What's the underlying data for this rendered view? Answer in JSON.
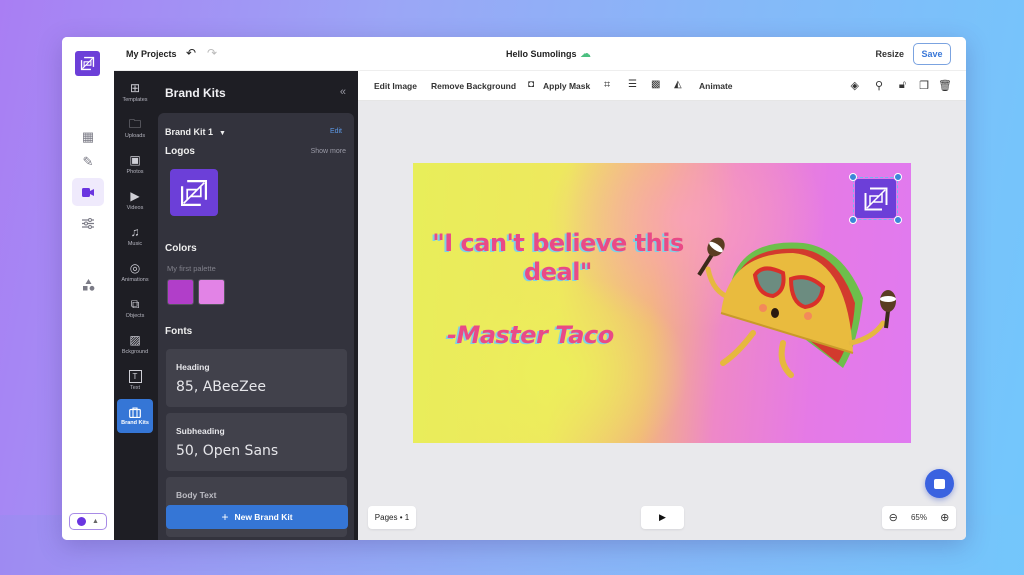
{
  "topbar": {
    "my_projects": "My Projects",
    "undo_icon": "↶",
    "redo_icon": "↷",
    "doc_title": "Hello Sumolings",
    "cloud_icon": "☁",
    "resize_label": "Resize",
    "save_label": "Save"
  },
  "rail": {
    "items": [
      {
        "name": "calendar",
        "icon": "▦"
      },
      {
        "name": "pencil",
        "icon": "✎"
      },
      {
        "name": "video",
        "icon": "■"
      },
      {
        "name": "sliders",
        "icon": "☰"
      },
      {
        "name": "shapes",
        "icon": "▲"
      }
    ],
    "active": "video"
  },
  "tools": [
    {
      "label": "Templates",
      "icon": "⊞"
    },
    {
      "label": "Uploads",
      "icon": "🗀"
    },
    {
      "label": "Photos",
      "icon": "▣"
    },
    {
      "label": "Videos",
      "icon": "▶"
    },
    {
      "label": "Music",
      "icon": "♫"
    },
    {
      "label": "Animations",
      "icon": "◎"
    },
    {
      "label": "Objects",
      "icon": "⧉"
    },
    {
      "label": "Bckground",
      "icon": "▨"
    },
    {
      "label": "Text",
      "icon": "T"
    },
    {
      "label": "Brand Kits",
      "icon": "💼"
    }
  ],
  "panel": {
    "title": "Brand Kits",
    "collapse_icon": "«",
    "kit_name": "Brand Kit 1",
    "kit_caret": "▼",
    "edit_label": "Edit",
    "logos_title": "Logos",
    "show_more": "Show more",
    "colors_title": "Colors",
    "palette_label": "My first palette",
    "colors": [
      "#b13ec9",
      "#e283e6"
    ],
    "fonts_title": "Fonts",
    "fonts": [
      {
        "label": "Heading",
        "value": "85, ABeeZee"
      },
      {
        "label": "Subheading",
        "value": "50, Open Sans"
      },
      {
        "label": "Body Text",
        "value": ""
      }
    ],
    "new_kit_plus": "+",
    "new_kit_label": "New Brand Kit"
  },
  "context_toolbar": {
    "edit_image": "Edit Image",
    "remove_background": "Remove Background",
    "apply_mask": "Apply Mask",
    "animate": "Animate"
  },
  "canvas": {
    "quote": "\"I can't believe this deal\"",
    "author": "-Master Taco"
  },
  "bottom": {
    "pages_label": "Pages • 1",
    "play_icon": "▶",
    "zoom_out_icon": "⊖",
    "zoom_level": "65%",
    "zoom_in_icon": "⊕"
  },
  "colors": {
    "accent_blue": "#3576d6",
    "brand_purple": "#6c3fd8",
    "quote_pink": "#e94a86"
  }
}
